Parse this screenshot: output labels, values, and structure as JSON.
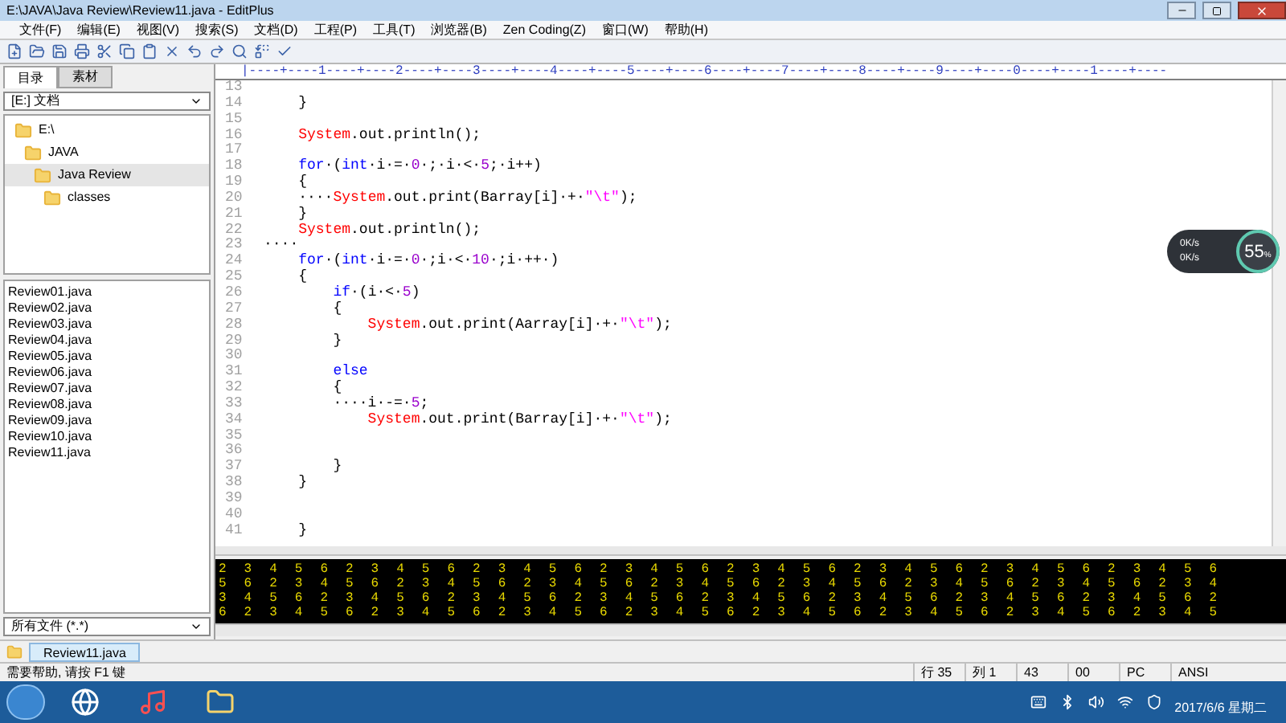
{
  "window": {
    "title": "E:\\JAVA\\Java Review\\Review11.java - EditPlus"
  },
  "menu": [
    "文件(F)",
    "编辑(E)",
    "视图(V)",
    "搜索(S)",
    "文档(D)",
    "工程(P)",
    "工具(T)",
    "浏览器(B)",
    "Zen Coding(Z)",
    "窗口(W)",
    "帮助(H)"
  ],
  "sidebar": {
    "tabs": [
      {
        "label": "目录",
        "selected": true
      },
      {
        "label": "素材",
        "selected": false
      }
    ],
    "drive": "[E:] 文档",
    "tree": [
      {
        "label": "E:\\",
        "selected": false,
        "children": [
          {
            "label": "JAVA",
            "selected": false,
            "children": [
              {
                "label": "Java Review",
                "selected": true,
                "children": [
                  {
                    "label": "classes",
                    "selected": false
                  }
                ]
              }
            ]
          }
        ]
      }
    ],
    "files": [
      "Review01.java",
      "Review02.java",
      "Review03.java",
      "Review04.java",
      "Review05.java",
      "Review06.java",
      "Review07.java",
      "Review08.java",
      "Review09.java",
      "Review10.java",
      "Review11.java"
    ],
    "filter": "所有文件 (*.*)"
  },
  "editor": {
    "ruler": "|----+----1----+----2----+----3----+----4----+----5----+----6----+----7----+----8----+----9----+----0----+----1----+----",
    "lines": [
      {
        "no": "13"
      },
      {
        "no": "14",
        "code": [
          {
            "kind": "plain",
            "text": "    }"
          }
        ]
      },
      {
        "no": "15"
      },
      {
        "no": "16",
        "code": [
          {
            "kind": "class",
            "text": "    System"
          },
          {
            "kind": "plain",
            "text": ".out.println();"
          }
        ]
      },
      {
        "no": "17"
      },
      {
        "no": "18",
        "code": [
          {
            "kind": "keyword",
            "text": "    for"
          },
          {
            "kind": "plain",
            "text": "·("
          },
          {
            "kind": "keyword",
            "text": "int"
          },
          {
            "kind": "plain",
            "text": "·i·=·"
          },
          {
            "kind": "number",
            "text": "0"
          },
          {
            "kind": "plain",
            "text": "·;·i·<·"
          },
          {
            "kind": "number",
            "text": "5"
          },
          {
            "kind": "plain",
            "text": ";·i++)"
          }
        ]
      },
      {
        "no": "19",
        "code": [
          {
            "kind": "plain",
            "text": "    {"
          }
        ]
      },
      {
        "no": "20",
        "code": [
          {
            "kind": "plain",
            "text": "    ····"
          },
          {
            "kind": "class",
            "text": "System"
          },
          {
            "kind": "plain",
            "text": ".out.print(Barray[i]·+·"
          },
          {
            "kind": "string",
            "text": "\"\\t\""
          },
          {
            "kind": "plain",
            "text": ");"
          }
        ]
      },
      {
        "no": "21",
        "code": [
          {
            "kind": "plain",
            "text": "    }"
          }
        ]
      },
      {
        "no": "22",
        "code": [
          {
            "kind": "class",
            "text": "    System"
          },
          {
            "kind": "plain",
            "text": ".out.println();"
          }
        ]
      },
      {
        "no": "23",
        "code": [
          {
            "kind": "plain",
            "text": "····"
          }
        ]
      },
      {
        "no": "24",
        "code": [
          {
            "kind": "keyword",
            "text": "    for"
          },
          {
            "kind": "plain",
            "text": "·("
          },
          {
            "kind": "keyword",
            "text": "int"
          },
          {
            "kind": "plain",
            "text": "·i·=·"
          },
          {
            "kind": "number",
            "text": "0"
          },
          {
            "kind": "plain",
            "text": "·;i·<·"
          },
          {
            "kind": "number",
            "text": "10"
          },
          {
            "kind": "plain",
            "text": "·;i·++·)"
          }
        ]
      },
      {
        "no": "25",
        "code": [
          {
            "kind": "plain",
            "text": "    {"
          }
        ]
      },
      {
        "no": "26",
        "code": [
          {
            "kind": "keyword",
            "text": "        if"
          },
          {
            "kind": "plain",
            "text": "·(i·<·"
          },
          {
            "kind": "number",
            "text": "5"
          },
          {
            "kind": "plain",
            "text": ")"
          }
        ]
      },
      {
        "no": "27",
        "code": [
          {
            "kind": "plain",
            "text": "        {"
          }
        ]
      },
      {
        "no": "28",
        "code": [
          {
            "kind": "class",
            "text": "            System"
          },
          {
            "kind": "plain",
            "text": ".out.print(Aarray[i]·+·"
          },
          {
            "kind": "string",
            "text": "\"\\t\""
          },
          {
            "kind": "plain",
            "text": ");"
          }
        ]
      },
      {
        "no": "29",
        "code": [
          {
            "kind": "plain",
            "text": "        }"
          }
        ]
      },
      {
        "no": "30"
      },
      {
        "no": "31",
        "code": [
          {
            "kind": "keyword",
            "text": "        else"
          }
        ]
      },
      {
        "no": "32",
        "code": [
          {
            "kind": "plain",
            "text": "        {"
          }
        ]
      },
      {
        "no": "33",
        "code": [
          {
            "kind": "plain",
            "text": "        ····i·-=·"
          },
          {
            "kind": "number",
            "text": "5"
          },
          {
            "kind": "plain",
            "text": ";"
          }
        ]
      },
      {
        "no": "34",
        "code": [
          {
            "kind": "class",
            "text": "            System"
          },
          {
            "kind": "plain",
            "text": ".out.print(Barray[i]·+·"
          },
          {
            "kind": "string",
            "text": "\"\\t\""
          },
          {
            "kind": "plain",
            "text": ");"
          }
        ]
      },
      {
        "no": "35"
      },
      {
        "no": "36"
      },
      {
        "no": "37",
        "code": [
          {
            "kind": "plain",
            "text": "        }"
          }
        ]
      },
      {
        "no": "38",
        "code": [
          {
            "kind": "plain",
            "text": "    }"
          }
        ]
      },
      {
        "no": "39"
      },
      {
        "no": "40"
      },
      {
        "no": "41",
        "code": [
          {
            "kind": "plain",
            "text": "    }"
          }
        ]
      }
    ]
  },
  "output": [
    "2 3 4 5 6 2 3 4 5 6 2 3 4 5 6 2 3 4 5 6 2 3 4 5 6 2 3 4 5 6 2 3 4 5 6 2 3 4 5 6",
    "5 6 2 3 4 5 6 2 3 4 5 6 2 3 4 5 6 2 3 4 5 6 2 3 4 5 6 2 3 4 5 6 2 3 4 5 6 2 3 4",
    "3 4 5 6 2 3 4 5 6 2 3 4 5 6 2 3 4 5 6 2 3 4 5 6 2 3 4 5 6 2 3 4 5 6 2 3 4 5 6 2",
    "6 2 3 4 5 6 2 3 4 5 6 2 3 4 5 6 2 3 4 5 6 2 3 4 5 6 2 3 4 5 6 2 3 4 5 6 2 3 4 5"
  ],
  "doc_tabs": [
    {
      "label": "Review11.java",
      "selected": true
    }
  ],
  "net_widget": {
    "up": "0K/s",
    "down": "0K/s",
    "value": "55",
    "unit": "%"
  },
  "status_bar": {
    "help": "需要帮助, 请按 F1 键",
    "fields": [
      "行 35",
      "列 1",
      "43",
      "00",
      "PC",
      "ANSI"
    ]
  },
  "taskbar": {
    "date": "2017/6/6 星期二"
  }
}
